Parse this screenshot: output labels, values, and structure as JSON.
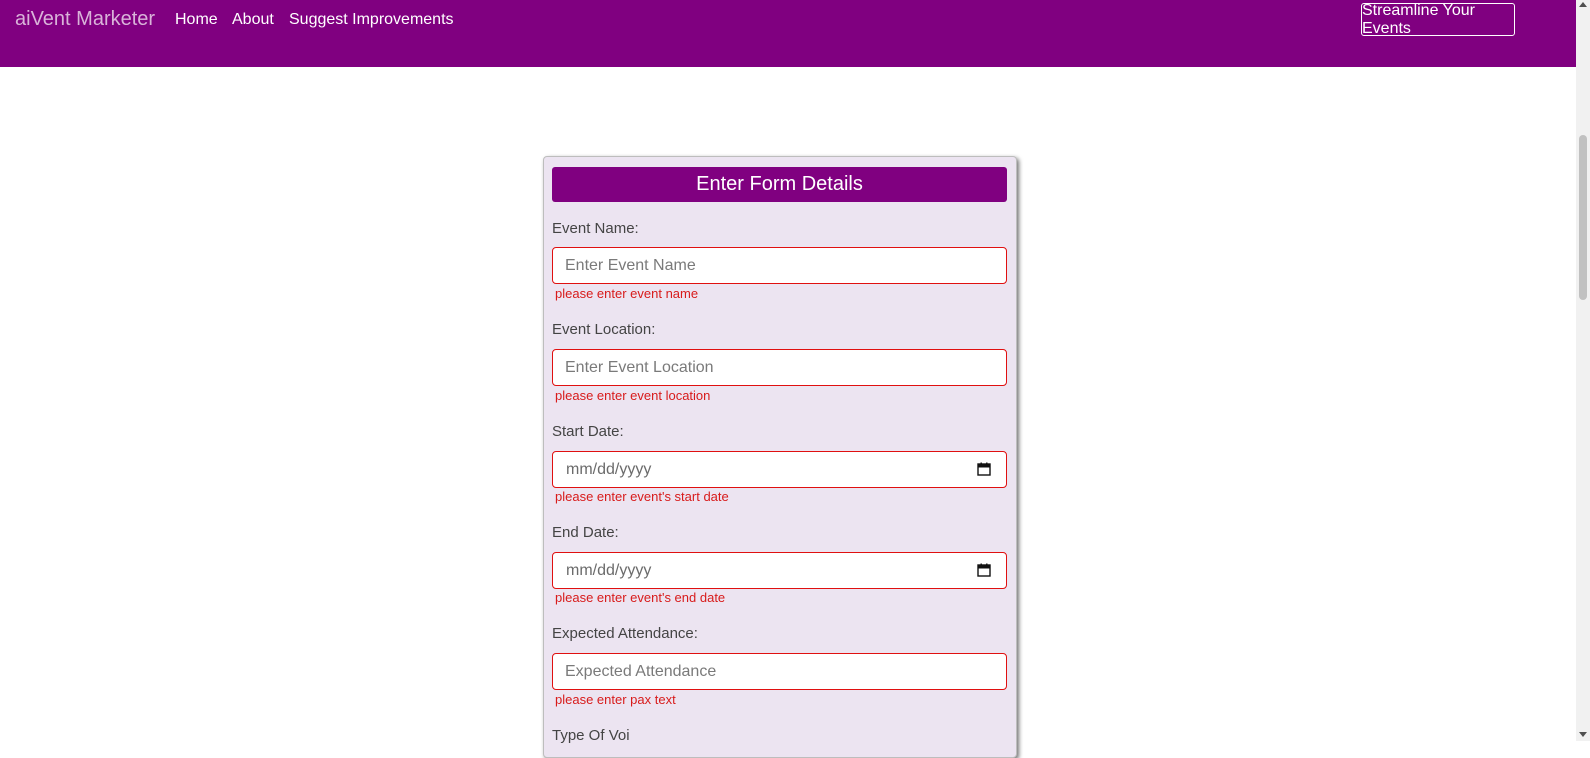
{
  "nav": {
    "brand": "aiVent Marketer",
    "links": [
      "Home",
      "About",
      "Suggest Improvements"
    ],
    "cta": "Streamline Your Events"
  },
  "form": {
    "title": "Enter Form Details",
    "fields": [
      {
        "label": "Event Name:",
        "placeholder": "Enter Event Name",
        "error": "please enter event name"
      },
      {
        "label": "Event Location:",
        "placeholder": "Enter Event Location",
        "error": "please enter event location"
      },
      {
        "label": "Start Date:",
        "placeholder": "mm/dd/yyyy",
        "error": "please enter event's start date"
      },
      {
        "label": "End Date:",
        "placeholder": "mm/dd/yyyy",
        "error": "please enter event's end date"
      },
      {
        "label": "Expected Attendance:",
        "placeholder": "Expected Attendance",
        "error": "please enter pax text"
      }
    ],
    "next_label_partial": "Type Of Voi"
  },
  "colors": {
    "brand": "#800080",
    "card_bg": "#ece4f1",
    "error": "#d81b1b"
  },
  "icons": {
    "date_picker": "calendar-icon"
  }
}
